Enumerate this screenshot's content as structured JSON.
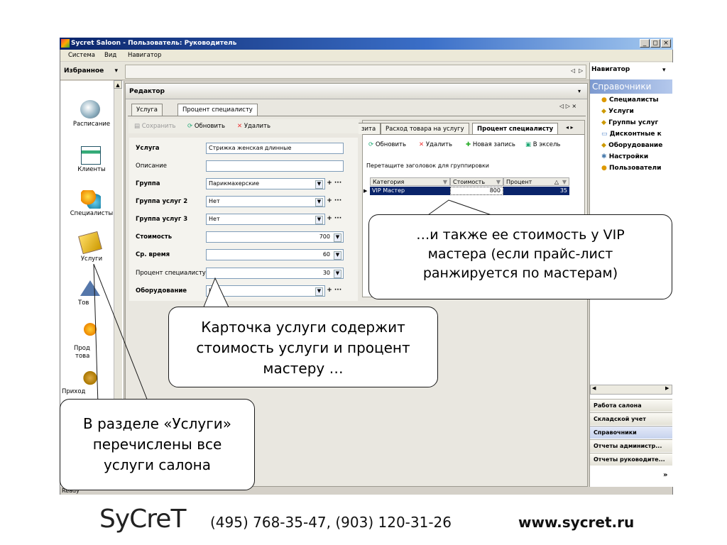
{
  "window": {
    "title": "Sycret Saloon - Пользователь: Руководитель"
  },
  "menu": {
    "items": [
      "Система",
      "Вид",
      "Навигатор"
    ]
  },
  "favorites": {
    "label": "Избранное"
  },
  "left_nav": {
    "items": [
      "Расписание",
      "Клиенты",
      "Специалисты",
      "Услуги",
      "Тов",
      "Прод",
      "това",
      "Приход"
    ]
  },
  "editor": {
    "title": "Редактор",
    "tabs": [
      "Услуга",
      "Процент специалисту"
    ],
    "toolbar": {
      "save": "Сохранить",
      "refresh": "Обновить",
      "delete": "Удалить"
    },
    "form": [
      {
        "label": "Услуга",
        "value": "Стрижка женская длинные"
      },
      {
        "label": "Описание",
        "value": ""
      },
      {
        "label": "Группа",
        "value": "Парикмахерские"
      },
      {
        "label": "Группа услуг 2",
        "value": "Нет"
      },
      {
        "label": "Группа услуг 3",
        "value": "Нет"
      },
      {
        "label": "Стоимость",
        "value": "700"
      },
      {
        "label": "Ср. время",
        "value": "60"
      },
      {
        "label": "Процент специалисту",
        "value": "30"
      },
      {
        "label": "Оборудование",
        "value": "Не"
      }
    ]
  },
  "subpanel": {
    "tabs": [
      "зита",
      "Расход товара на услугу",
      "Процент специалисту"
    ],
    "toolbar": {
      "refresh": "Обновить",
      "delete": "Удалить",
      "new": "Новая запись",
      "excel": "В эксель"
    },
    "group_hint": "Перетащите заголовок для группировки",
    "columns": [
      "Категория",
      "Стоимость",
      "Процент"
    ],
    "rows": [
      {
        "category": "VIP Мастер",
        "cost": "800",
        "percent": "35"
      }
    ]
  },
  "navigator": {
    "title": "Навигатор",
    "header": "Справочники",
    "tree": [
      "Специалисты",
      "Услуги",
      "Группы услуг",
      "Дисконтные к",
      "Оборудование",
      "Настройки",
      "Пользователи"
    ],
    "buttons": [
      "Работа салона",
      "Складской учет",
      "Справочники",
      "Отчеты администр...",
      "Отчеты руководите..."
    ],
    "more": "»"
  },
  "status": {
    "text": "Ready"
  },
  "callouts": {
    "vip": "…и также ее стоимость у VIP мастера (если прайс-лист ранжируется по мастерам)",
    "card": "Карточка услуги содержит стоимость услуги и процент мастеру …",
    "services": "В разделе «Услуги» перечислены все услуги салона"
  },
  "footer": {
    "logo": "SyCreT",
    "phones": "(495) 768-35-47, (903) 120-31-26",
    "site": "www.sycret.ru"
  }
}
